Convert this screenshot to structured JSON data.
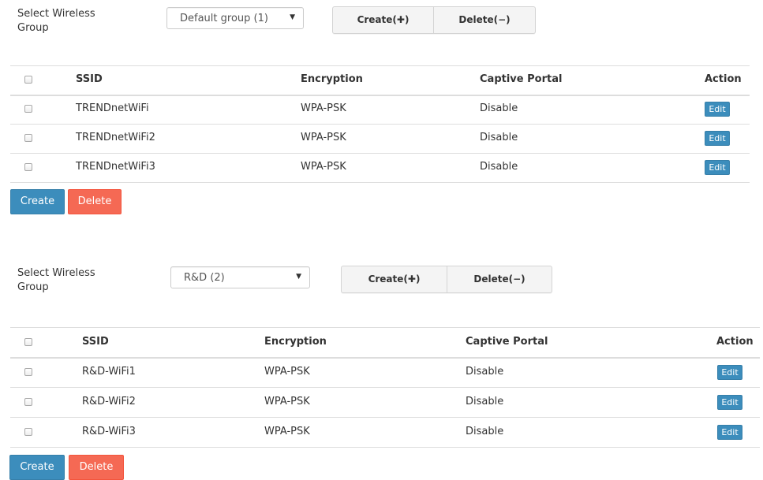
{
  "groups": [
    {
      "select_label": "Select Wireless Group",
      "selected_group": "Default group (1)",
      "create_group_label": "Create(✚)",
      "delete_group_label": "Delete(−)",
      "columns": [
        "SSID",
        "Encryption",
        "Captive Portal",
        "Action"
      ],
      "rows": [
        {
          "ssid": "TRENDnetWiFi",
          "encryption": "WPA-PSK",
          "captive_portal": "Disable",
          "action": "Edit"
        },
        {
          "ssid": "TRENDnetWiFi2",
          "encryption": "WPA-PSK",
          "captive_portal": "Disable",
          "action": "Edit"
        },
        {
          "ssid": "TRENDnetWiFi3",
          "encryption": "WPA-PSK",
          "captive_portal": "Disable",
          "action": "Edit"
        }
      ],
      "create_label": "Create",
      "delete_label": "Delete"
    },
    {
      "select_label": "Select Wireless Group",
      "selected_group": "R&D (2)",
      "create_group_label": "Create(✚)",
      "delete_group_label": "Delete(−)",
      "columns": [
        "SSID",
        "Encryption",
        "Captive Portal",
        "Action"
      ],
      "rows": [
        {
          "ssid": "R&D-WiFi1",
          "encryption": "WPA-PSK",
          "captive_portal": "Disable",
          "action": "Edit"
        },
        {
          "ssid": "R&D-WiFi2",
          "encryption": "WPA-PSK",
          "captive_portal": "Disable",
          "action": "Edit"
        },
        {
          "ssid": "R&D-WiFi3",
          "encryption": "WPA-PSK",
          "captive_portal": "Disable",
          "action": "Edit"
        }
      ],
      "create_label": "Create",
      "delete_label": "Delete"
    }
  ],
  "colors": {
    "primary": "#3c8dbc",
    "danger": "#f56954",
    "border": "#dddddd"
  }
}
